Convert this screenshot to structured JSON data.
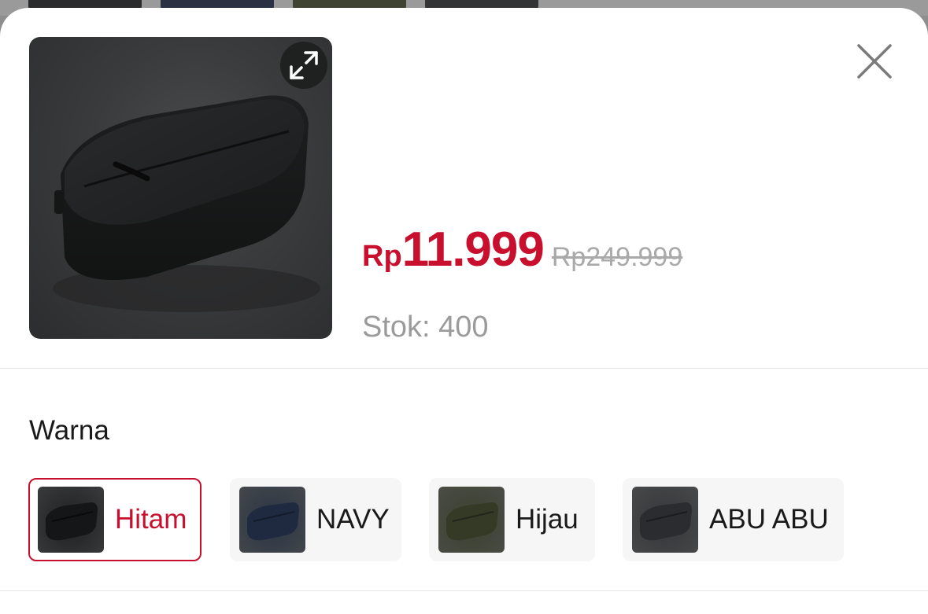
{
  "product": {
    "image_icon": "bag-photo",
    "price_currency": "Rp",
    "price_value": "11.999",
    "original_price": "Rp249.999",
    "stock": "Stok: 400"
  },
  "actions": {
    "expand_icon": "expand-icon",
    "close_icon": "close-icon"
  },
  "variant": {
    "label": "Warna",
    "options": [
      {
        "label": "Hitam",
        "selected": true,
        "color": "#2b2c2d"
      },
      {
        "label": "NAVY",
        "selected": false,
        "color": "#2d3952"
      },
      {
        "label": "Hijau",
        "selected": false,
        "color": "#4a5038"
      },
      {
        "label": "ABU ABU",
        "selected": false,
        "color": "#3c3d3f"
      }
    ]
  },
  "colors": {
    "accent": "#c8102e",
    "muted": "#9b9b9b"
  }
}
